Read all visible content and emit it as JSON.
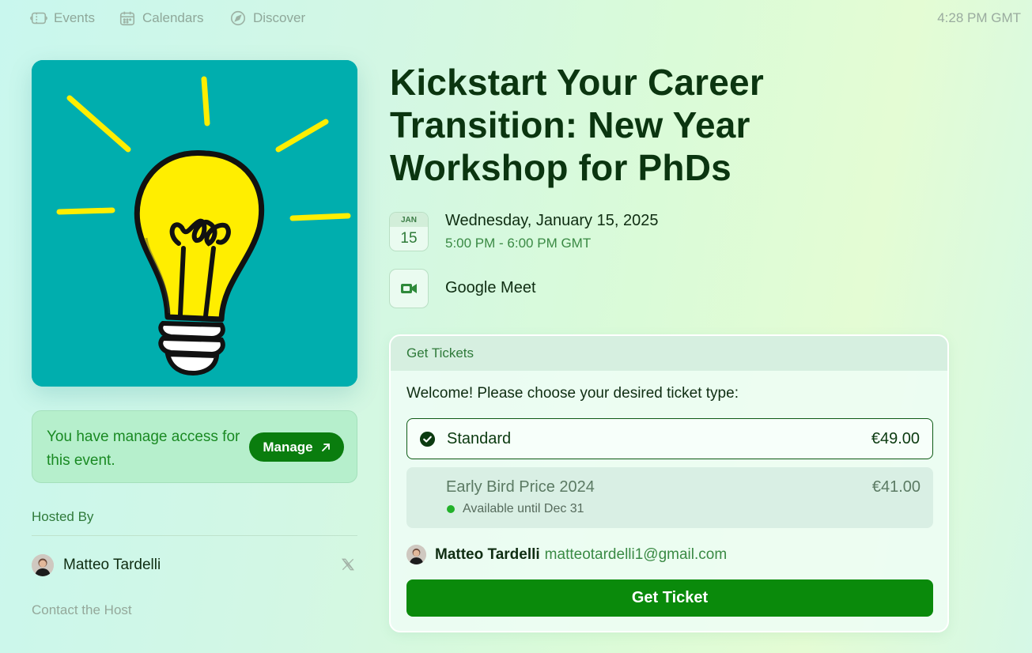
{
  "nav": {
    "items": [
      {
        "label": "Events",
        "icon": "ticket-icon"
      },
      {
        "label": "Calendars",
        "icon": "calendar-icon"
      },
      {
        "label": "Discover",
        "icon": "compass-icon"
      }
    ],
    "time": "4:28 PM GMT"
  },
  "event": {
    "title": "Kickstart Your Career Transition: New Year Workshop for PhDs",
    "cover_icon": "lightbulb-illustration",
    "date": {
      "month": "JAN",
      "day": "15",
      "full": "Wednesday, January 15, 2025",
      "time": "5:00 PM - 6:00 PM GMT"
    },
    "location": {
      "label": "Google Meet",
      "icon": "video-camera-icon"
    }
  },
  "manage": {
    "text": "You have manage access for this event.",
    "button_label": "Manage",
    "button_icon": "arrow-up-right-icon"
  },
  "host": {
    "label": "Hosted By",
    "name": "Matteo Tardelli",
    "social_icon": "x-logo-icon",
    "contact_label": "Contact the Host"
  },
  "tickets": {
    "header": "Get Tickets",
    "welcome": "Welcome! Please choose your desired ticket type:",
    "options": [
      {
        "name": "Standard",
        "price": "€49.00",
        "selected": true
      },
      {
        "name": "Early Bird Price 2024",
        "price": "€41.00",
        "availability": "Available until Dec 31",
        "selected": false
      }
    ],
    "user": {
      "name": "Matteo Tardelli",
      "email": "matteotardelli1@gmail.com"
    },
    "button_label": "Get Ticket"
  },
  "colors": {
    "accent": "#0a8a0b",
    "cover_bg": "#00aeae",
    "bulb": "#ffee00"
  }
}
